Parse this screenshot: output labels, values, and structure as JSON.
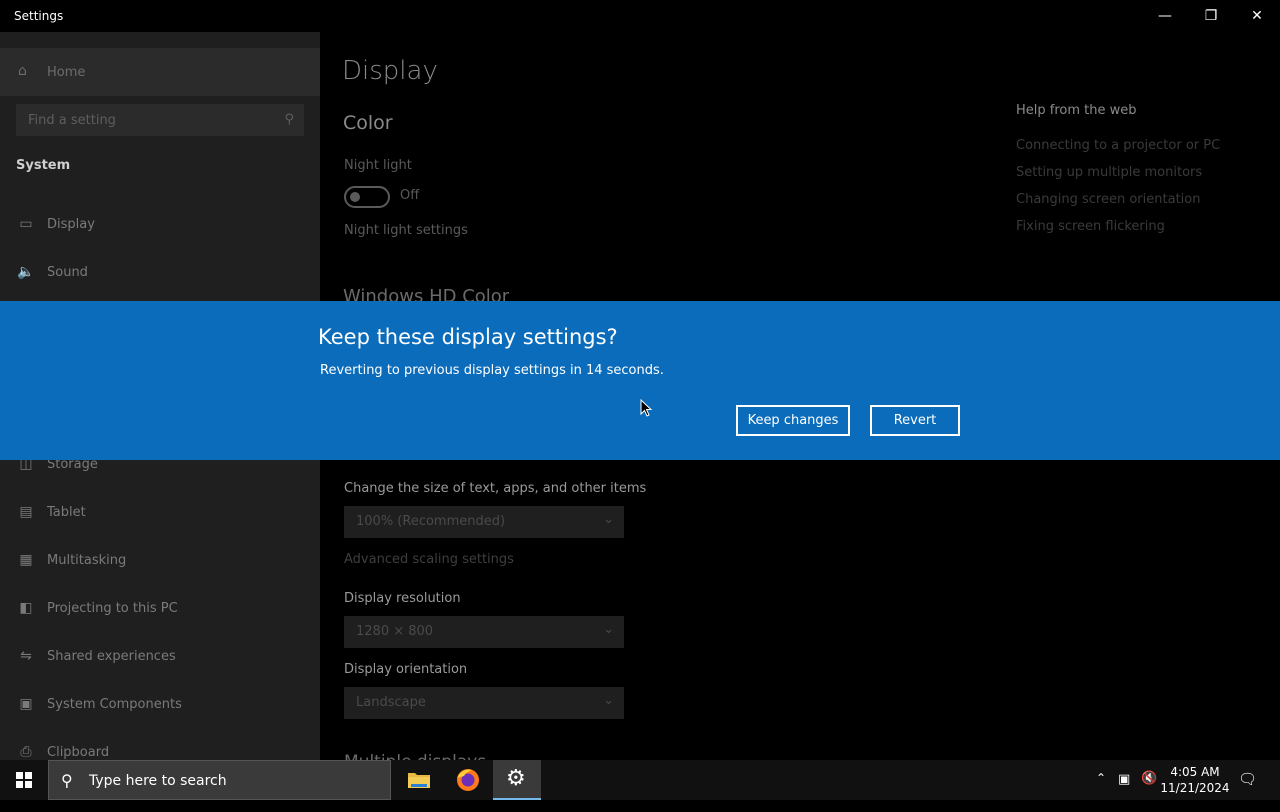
{
  "window": {
    "title": "Settings",
    "minimize_icon": "minimize-icon",
    "restore_icon": "restore-icon",
    "close_icon": "close-icon"
  },
  "sidebar": {
    "home_label": "Home",
    "search_placeholder": "Find a setting",
    "section_title": "System",
    "items": [
      {
        "label": "Display",
        "icon": "monitor-icon",
        "selected": true
      },
      {
        "label": "Sound",
        "icon": "speaker-icon"
      },
      {
        "label": "Storage",
        "icon": "storage-icon"
      },
      {
        "label": "Tablet",
        "icon": "tablet-icon"
      },
      {
        "label": "Multitasking",
        "icon": "multitasking-icon"
      },
      {
        "label": "Projecting to this PC",
        "icon": "projecting-icon"
      },
      {
        "label": "Shared experiences",
        "icon": "shared-experiences-icon"
      },
      {
        "label": "System Components",
        "icon": "system-components-icon"
      },
      {
        "label": "Clipboard",
        "icon": "clipboard-icon"
      }
    ]
  },
  "main": {
    "page_title": "Display",
    "color_heading": "Color",
    "night_light_label": "Night light",
    "night_light_state": "Off",
    "night_light_settings_link": "Night light settings",
    "hd_color_heading": "Windows HD Color",
    "scale_label": "Change the size of text, apps, and other items",
    "scale_value": "100% (Recommended)",
    "advanced_scaling_link": "Advanced scaling settings",
    "resolution_label": "Display resolution",
    "resolution_value": "1280 × 800",
    "orientation_label": "Display orientation",
    "orientation_value": "Landscape",
    "multiple_displays_heading": "Multiple displays"
  },
  "help": {
    "title": "Help from the web",
    "links": [
      "Connecting to a projector or PC",
      "Setting up multiple monitors",
      "Changing screen orientation",
      "Fixing screen flickering"
    ]
  },
  "dialog": {
    "title": "Keep these display settings?",
    "message": "Reverting to previous display settings in 14 seconds.",
    "keep_label": "Keep changes",
    "revert_label": "Revert",
    "color": "#0a6cbb"
  },
  "taskbar": {
    "search_placeholder": "Type here to search",
    "time": "4:05 AM",
    "date": "11/21/2024"
  }
}
